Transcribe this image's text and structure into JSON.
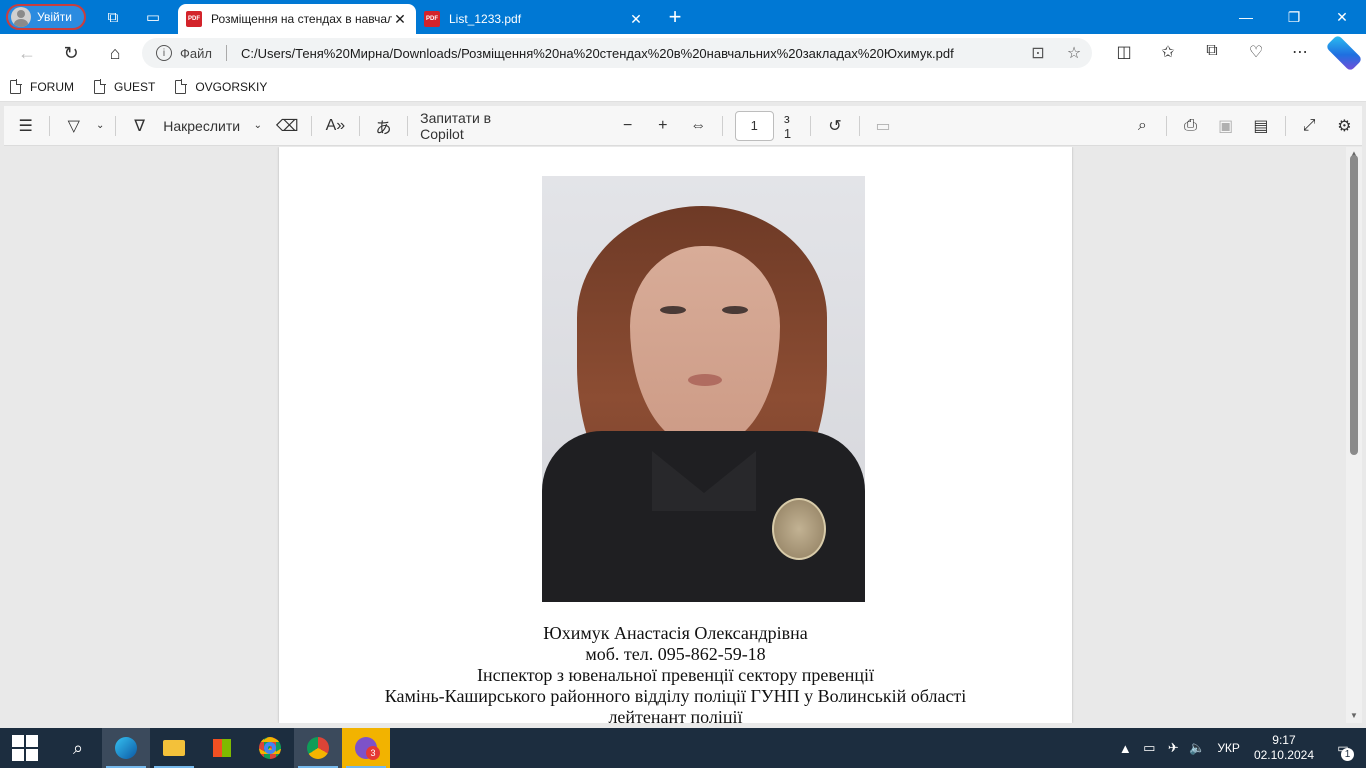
{
  "browser": {
    "profile_label": "Увійти",
    "tabs": [
      {
        "label": "Розміщення на стендах в навчальних закладах Юхимук.pdf",
        "active": true
      },
      {
        "label": "List_1233.pdf",
        "active": false
      }
    ],
    "address": {
      "scheme": "Файл",
      "url": "C:/Users/Теня%20Мирна/Downloads/Розміщення%20на%20стендах%20в%20навчальних%20закладах%20Юхимук.pdf"
    },
    "favorites": [
      "FORUM",
      "GUEST",
      "OVGORSKIY"
    ]
  },
  "pdf_toolbar": {
    "draw_label": "Накреслити",
    "copilot_label": "Запитати в Copilot",
    "page_current": "1",
    "page_total": "з 1"
  },
  "document": {
    "caption_lines": [
      "Юхимук Анастасія Олександрівна",
      "моб. тел. 095-862-59-18",
      "Інспектор з ювенальної превенції сектору превенції",
      "Камінь-Каширського районного відділу поліції ГУНП у Волинській області",
      "лейтенант поліції"
    ]
  },
  "taskbar": {
    "language": "УКР",
    "time": "9:17",
    "date": "02.10.2024",
    "viber_badge": "3",
    "notifications_count": "1"
  },
  "colors": {
    "accent": "#0078d4",
    "taskbar": "#1c2d3f",
    "pdf_icon": "#d3232a"
  }
}
